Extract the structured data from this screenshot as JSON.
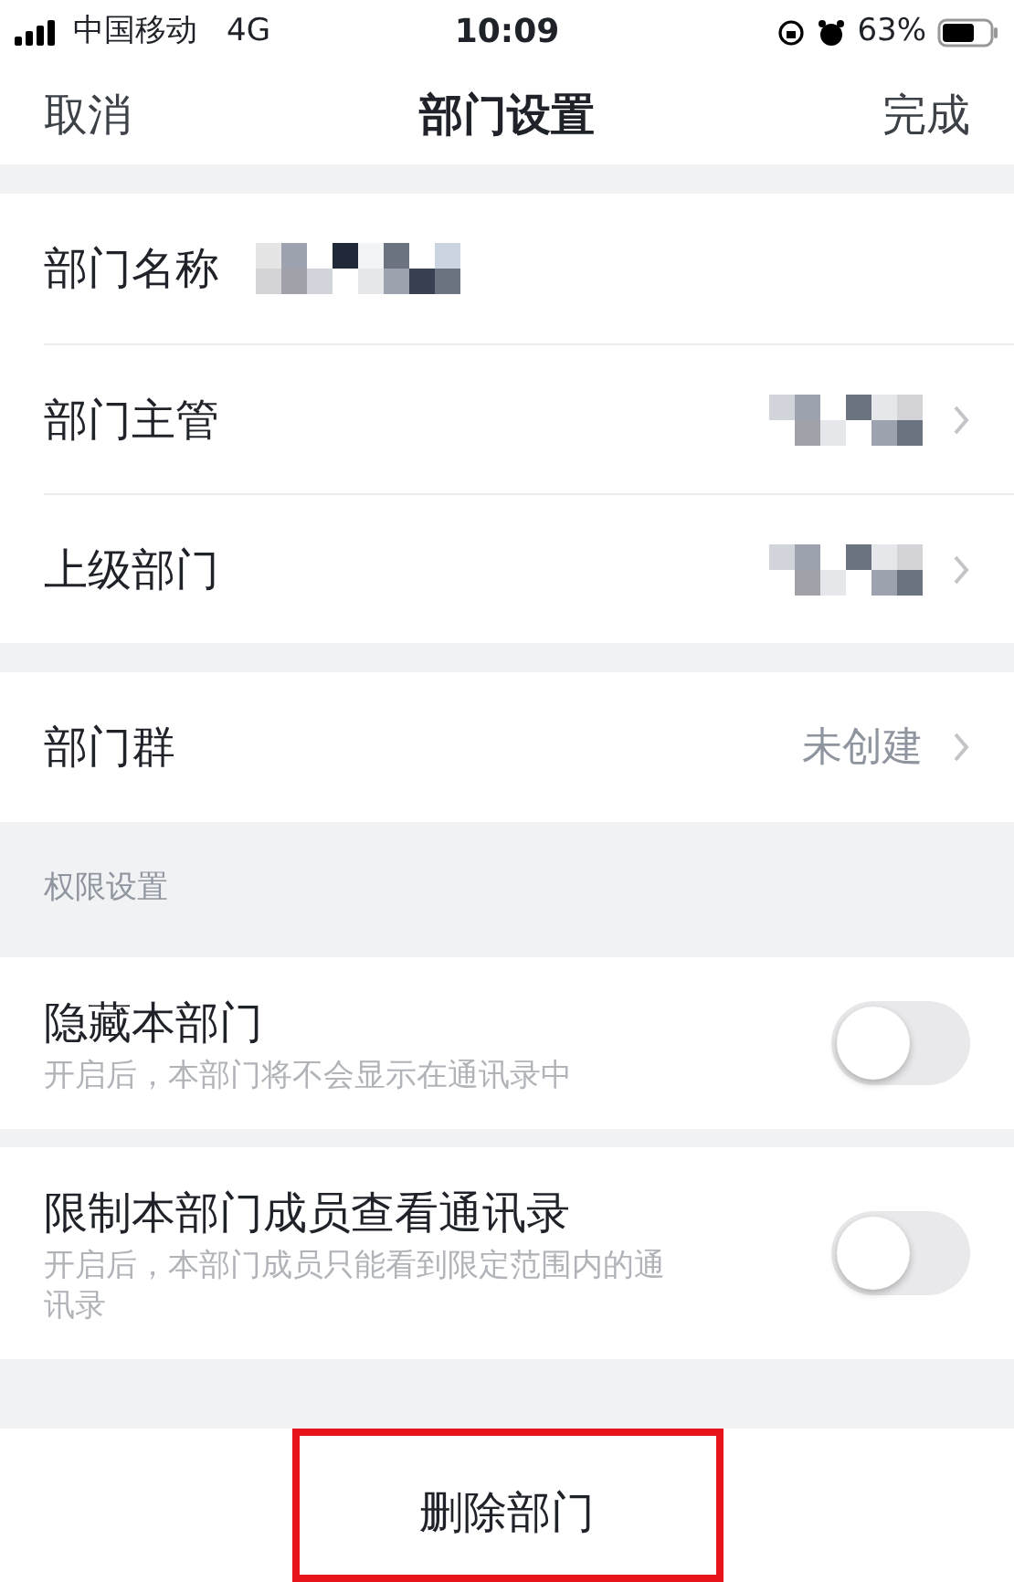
{
  "status_bar": {
    "carrier": "中国移动",
    "network": "4G",
    "time": "10:09",
    "battery": "63%"
  },
  "nav": {
    "left": "取消",
    "title": "部门设置",
    "right": "完成"
  },
  "groups": [
    [
      {
        "label": "部门名称",
        "redacted": true,
        "chevron": false
      },
      {
        "label": "部门主管",
        "redacted": true,
        "chevron": true
      },
      {
        "label": "上级部门",
        "redacted": true,
        "chevron": true
      }
    ],
    [
      {
        "label": "部门群",
        "value": "未创建",
        "chevron": true
      }
    ]
  ],
  "permissions": {
    "header": "权限设置",
    "items": [
      {
        "label": "隐藏本部门",
        "hint": "开启后，本部门将不会显示在通讯录中",
        "on": false
      },
      {
        "label": "限制本部门成员查看通讯录",
        "hint": "开启后，本部门成员只能看到限定范围内的通讯录",
        "on": false
      }
    ]
  },
  "delete": {
    "label": "删除部门",
    "highlighted": true
  }
}
